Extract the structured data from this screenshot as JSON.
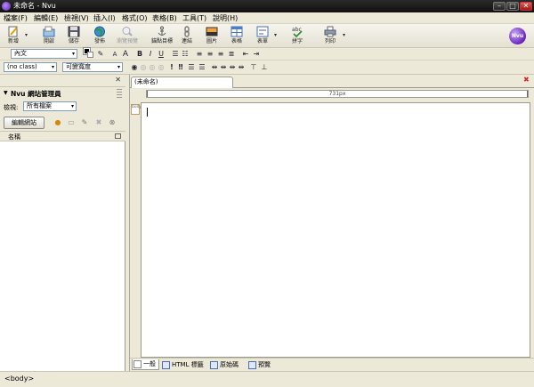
{
  "window": {
    "title": "未命名 - Nvu"
  },
  "menubar": [
    "檔案(F)",
    "編輯(E)",
    "檢視(V)",
    "插入(I)",
    "格式(O)",
    "表格(B)",
    "工具(T)",
    "說明(H)"
  ],
  "toolbar": {
    "new": "新增",
    "open": "開啟",
    "save": "儲存",
    "publish": "發佈",
    "browse": "瀏覽預覽",
    "anchor": "錨點目標",
    "link": "連結",
    "image": "圖片",
    "table": "表格",
    "form": "表單",
    "spell": "拼字",
    "print": "列印",
    "logo": "Nvu"
  },
  "format1": {
    "paragraph_format": "內文",
    "font": "可變寬度",
    "css_class": "(no class)"
  },
  "site_manager": {
    "title": "Nvu 網站管理員",
    "view_label": "檢視:",
    "view_value": "所有檔案",
    "edit_sites": "編輯網站",
    "name_column": "名稱"
  },
  "document": {
    "tab_label": "(未命名)",
    "ruler_label": "731px",
    "tag_marker": "body"
  },
  "mode_tabs": [
    "一般",
    "HTML 標籤",
    "原始碼",
    "預覽"
  ],
  "statusbar": {
    "text": "<body>"
  },
  "colors": {
    "titlebar": "#1a1a1a",
    "chrome": "#ece9d8",
    "accent": "#6a24b8",
    "close": "#d22"
  }
}
